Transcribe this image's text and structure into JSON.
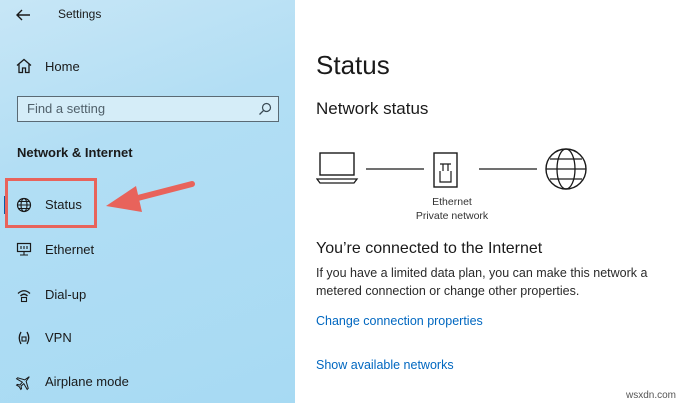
{
  "titlebar": {
    "app_title": "Settings"
  },
  "sidebar": {
    "home_label": "Home",
    "search_placeholder": "Find a setting",
    "section_title": "Network & Internet",
    "items": [
      {
        "label": "Status",
        "icon": "globe-icon"
      },
      {
        "label": "Ethernet",
        "icon": "ethernet-icon"
      },
      {
        "label": "Dial-up",
        "icon": "dialup-icon"
      },
      {
        "label": "VPN",
        "icon": "vpn-icon"
      },
      {
        "label": "Airplane mode",
        "icon": "airplane-icon"
      }
    ]
  },
  "main": {
    "title": "Status",
    "subtitle": "Network status",
    "diagram": {
      "adapter_name": "Ethernet",
      "network_name": "Private network"
    },
    "connected_heading": "You’re connected to the Internet",
    "description": "If you have a limited data plan, you can make this network a metered connection or change other properties.",
    "links": {
      "change_connection": "Change connection properties",
      "show_networks": "Show available networks"
    }
  },
  "watermark": "wsxdn.com",
  "colors": {
    "highlight": "#e8635b",
    "link": "#0067c0",
    "sidebar_bg": "#b2def4"
  }
}
